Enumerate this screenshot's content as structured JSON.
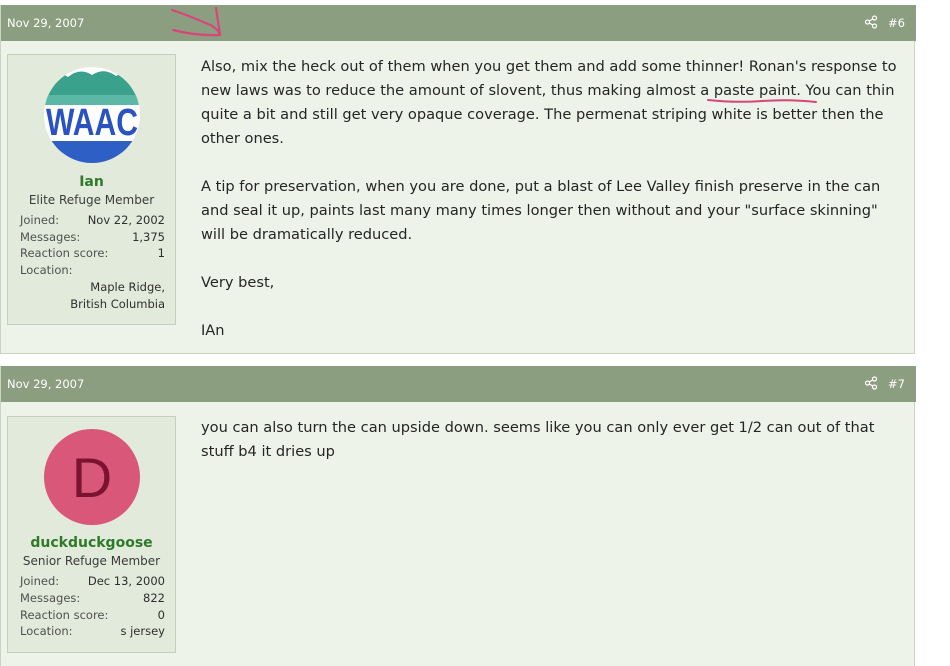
{
  "posts": [
    {
      "date": "Nov 29, 2007",
      "number": "#6",
      "user": {
        "avatar_text": "WAAC",
        "name": "Ian",
        "title": "Elite Refuge Member",
        "joined_label": "Joined:",
        "joined": "Nov 22, 2002",
        "messages_label": "Messages:",
        "messages": "1,375",
        "reaction_label": "Reaction score:",
        "reaction": "1",
        "location_label": "Location:",
        "location": "Maple Ridge, British Columbia"
      },
      "body": {
        "p1_before": "Also, mix the heck out of them when you get them and add some thinner! Ronan's response to new laws was to reduce the amount of slovent, thus making almost a ",
        "p1_underlined": "paste paint",
        "p1_after": ". You can thin quite a bit and still get very opaque coverage. The permenat striping white is better then the other ones.",
        "p2": "A tip for preservation, when you are done, put a blast of Lee Valley finish preserve in the can and seal it up, paints last many many times longer then without and your \"surface skinning\" will be dramatically reduced.",
        "p3": "Very best,",
        "p4": "IAn"
      }
    },
    {
      "date": "Nov 29, 2007",
      "number": "#7",
      "user": {
        "avatar_letter": "D",
        "name": "duckduckgoose",
        "title": "Senior Refuge Member",
        "joined_label": "Joined:",
        "joined": "Dec 13, 2000",
        "messages_label": "Messages:",
        "messages": "822",
        "reaction_label": "Reaction score:",
        "reaction": "0",
        "location_label": "Location:",
        "location": "s jersey"
      },
      "body": {
        "p1": "you can also turn the can upside down. seems like you can only ever get 1/2 can out of that stuff b4 it dries up"
      }
    }
  ],
  "colors": {
    "header_bg": "#8c9e80",
    "post_bg": "#eef3e9",
    "user_card_bg": "#e2eadb",
    "username": "#2f7a2a",
    "avatar_d_bg": "#d9587a",
    "avatar_d_fg": "#7a1230",
    "annotation": "#d6467a"
  },
  "icons": [
    "share-icon",
    "annotation-arrow-icon"
  ]
}
